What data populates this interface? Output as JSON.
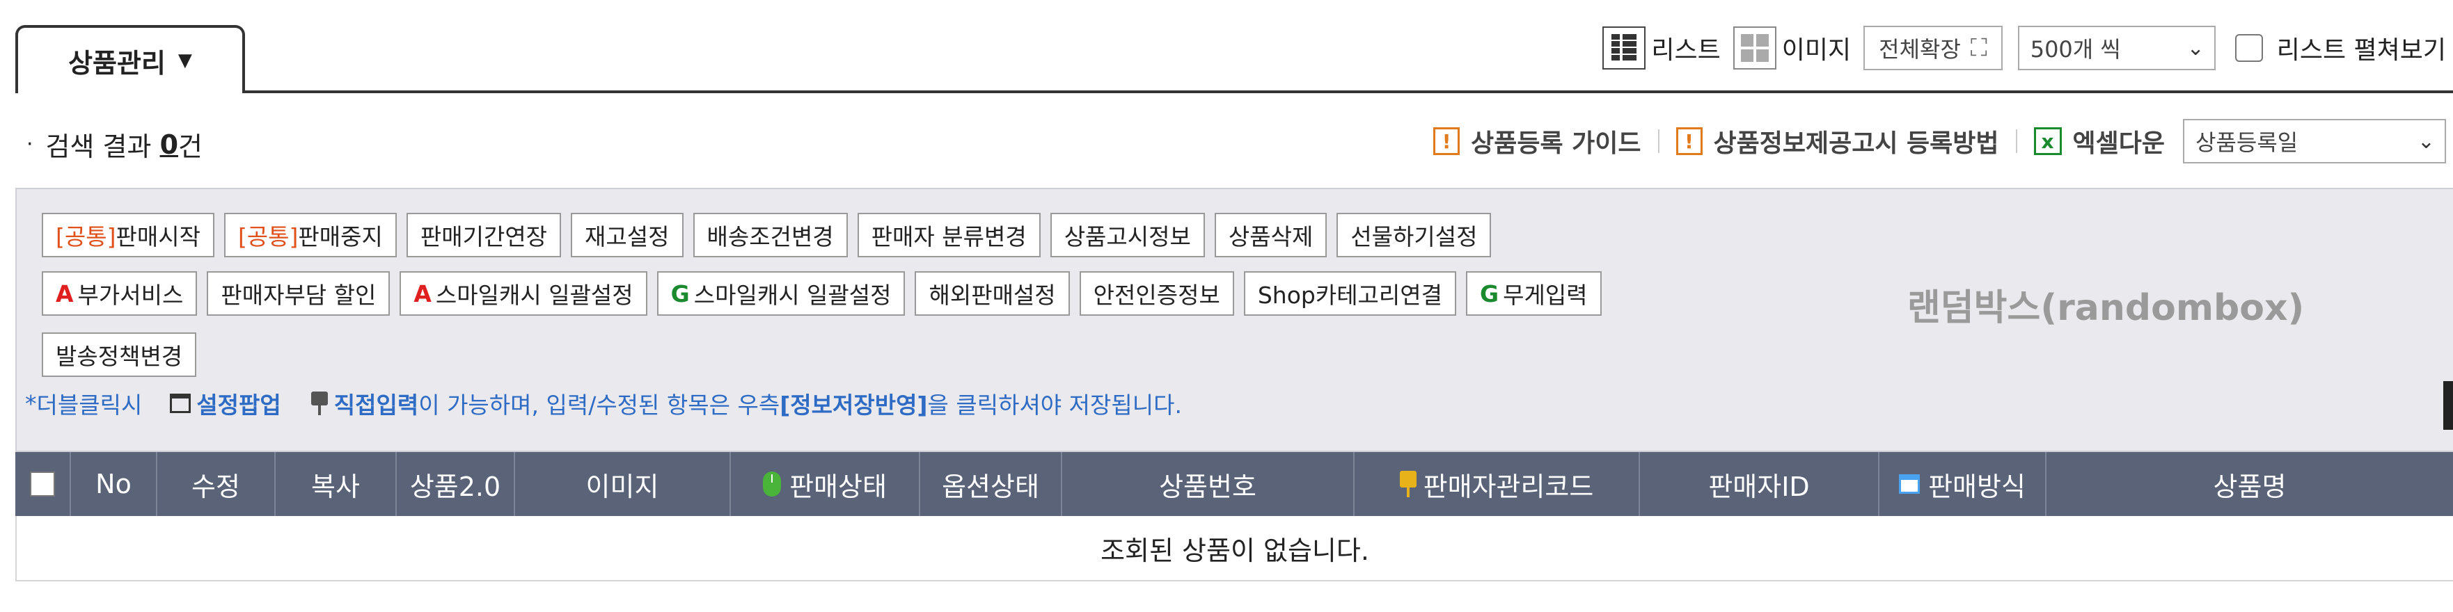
{
  "tab": {
    "label": "상품관리",
    "icon": "caret-down-icon"
  },
  "toolbar": {
    "list_label": "리스트",
    "image_label": "이미지",
    "expand_label": "전체확장",
    "page_size": "500개 씩",
    "spread_label": "리스트 펼쳐보기"
  },
  "result": {
    "prefix": "검색 결과",
    "count": "0",
    "suffix": "건"
  },
  "links": {
    "guide": "상품등록 가이드",
    "notice_guide": "상품정보제공고시 등록방법",
    "excel": "엑셀다운",
    "sort": "상품등록일"
  },
  "actions": {
    "row1": [
      {
        "tag": "[공통]",
        "label": "판매시작"
      },
      {
        "tag": "[공통]",
        "label": "판매중지"
      },
      {
        "label": "판매기간연장"
      },
      {
        "label": "재고설정"
      },
      {
        "label": "배송조건변경"
      },
      {
        "label": "판매자 분류변경"
      },
      {
        "label": "상품고시정보"
      },
      {
        "label": "상품삭제"
      },
      {
        "label": "선물하기설정"
      }
    ],
    "row2": [
      {
        "mark": "A",
        "label": "부가서비스"
      },
      {
        "label": "판매자부담 할인"
      },
      {
        "mark": "A",
        "label": "스마일캐시 일괄설정"
      },
      {
        "mark": "G",
        "label": "스마일캐시 일괄설정"
      },
      {
        "label": "해외판매설정"
      },
      {
        "label": "안전인증정보"
      },
      {
        "label": "Shop카테고리연결"
      },
      {
        "mark": "G",
        "label": "무게입력"
      }
    ],
    "row3": [
      {
        "label": "발송정책변경"
      }
    ]
  },
  "watermark": "랜덤박스(randombox)",
  "help": {
    "star": "*",
    "dbl": "더블클릭시",
    "popup": "설정팝업",
    "direct": "직접입력",
    "rest1": "이 가능하며, 입력/수정된 항목은 우측 ",
    "save": "[정보저장반영]",
    "rest2": "을 클릭하셔야 저장됩니다."
  },
  "table": {
    "headers": [
      "No",
      "수정",
      "복사",
      "상품2.0",
      "이미지",
      "판매상태",
      "옵션상태",
      "상품번호",
      "판매자관리코드",
      "판매자ID",
      "판매방식",
      "상품명"
    ],
    "empty": "조회된 상품이 없습니다."
  },
  "colors": {
    "header_bg": "#5a6377",
    "panel_bg": "#e9e9ee",
    "accent_orange": "#e0501a",
    "link_blue": "#2d6bc4"
  }
}
